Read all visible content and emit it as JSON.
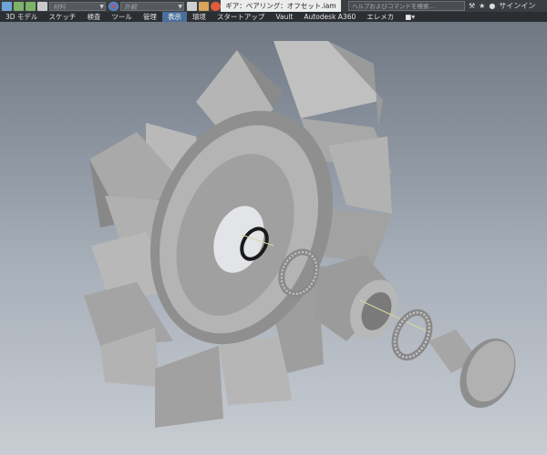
{
  "toolbar": {
    "material_placeholder": "材料",
    "appearance_placeholder": "外観",
    "document_title": "ギア：ベアリング：オフセット.iam",
    "search_placeholder": "ヘルプおよびコマンドを検索...",
    "signin_label": "サインイン"
  },
  "menu": {
    "tabs": [
      "3D モデル",
      "スケッチ",
      "検査",
      "ツール",
      "管理",
      "表示",
      "環境",
      "スタートアップ",
      "Vault",
      "Autodesk A360",
      "エレメカ"
    ],
    "active_tab": "表示",
    "more_label": "■▾"
  },
  "colors": {
    "ribbon_dark": "#2b2e32",
    "tab_active": "#4a6f9a",
    "part_grey": "#9a9a9a"
  },
  "icons": [
    "save-icon",
    "undo-icon",
    "redo-icon",
    "home-icon",
    "appearance-icon",
    "parameters-icon",
    "measure-icon",
    "exchange-icon",
    "star-icon",
    "user-icon",
    "help-icon"
  ]
}
